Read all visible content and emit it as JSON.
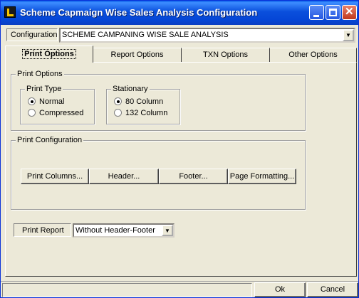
{
  "window": {
    "title": "Scheme Capmaign Wise Sales Analysis Configuration",
    "icon": "app-logo-icon"
  },
  "configuration": {
    "label": "Configuration",
    "value": "SCHEME CAMPANING WISE SALE ANALYSIS"
  },
  "tabs": [
    {
      "label": "Print Options",
      "active": true
    },
    {
      "label": "Report Options",
      "active": false
    },
    {
      "label": "TXN Options",
      "active": false
    },
    {
      "label": "Other Options",
      "active": false
    }
  ],
  "print_options": {
    "group_title": "Print Options",
    "print_type": {
      "title": "Print Type",
      "options": [
        {
          "label": "Normal",
          "checked": true
        },
        {
          "label": "Compressed",
          "checked": false
        }
      ]
    },
    "stationary": {
      "title": "Stationary",
      "options": [
        {
          "label": "80 Column",
          "checked": true
        },
        {
          "label": "132 Column",
          "checked": false
        }
      ]
    }
  },
  "print_configuration": {
    "title": "Print Configuration",
    "buttons": [
      "Print Columns...",
      "Header...",
      "Footer...",
      "Page Formatting..."
    ]
  },
  "print_report": {
    "label": "Print Report",
    "value": "Without Header-Footer"
  },
  "footer": {
    "ok_label": "Ok",
    "cancel_label": "Cancel"
  }
}
